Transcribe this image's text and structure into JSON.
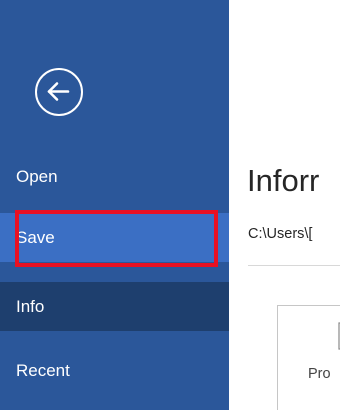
{
  "sidebar": {
    "back_icon": "arrow-left-circle-icon",
    "items": [
      {
        "label": "Open"
      },
      {
        "label": "Save"
      },
      {
        "label": "Info"
      },
      {
        "label": "Recent"
      }
    ]
  },
  "main": {
    "title": "Inforr",
    "path": "C:\\Users\\[",
    "card_label": "Pro",
    "card_icon": "document-icon"
  },
  "colors": {
    "sidebar_bg": "#2b579a",
    "selected_bg": "#1e3f6e",
    "hover_bg": "#3b6fc4",
    "highlight_border": "#e81123"
  }
}
